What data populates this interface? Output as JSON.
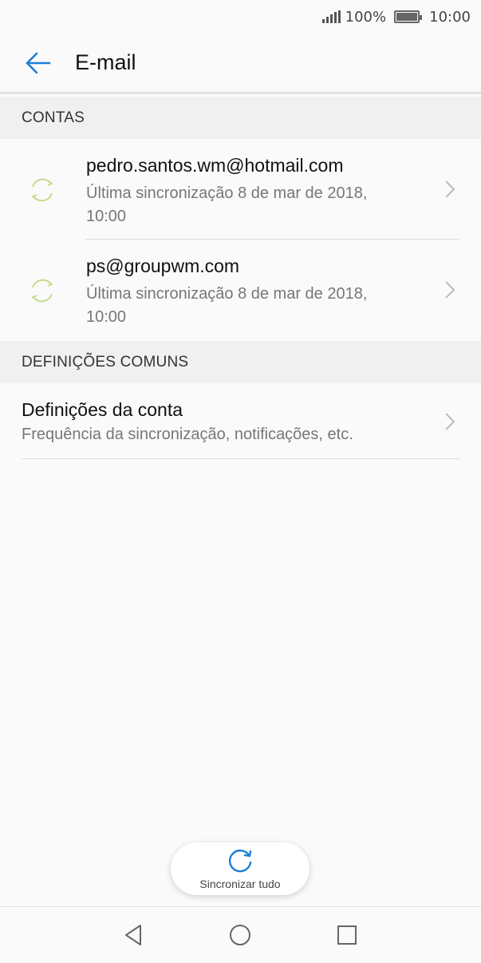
{
  "status_bar": {
    "battery_text": "100%",
    "time": "10:00"
  },
  "app_bar": {
    "title": "E-mail",
    "back_icon": "arrow-left-icon"
  },
  "sections": {
    "accounts_header": "CONTAS",
    "common_header": "DEFINIÇÕES COMUNS"
  },
  "accounts": [
    {
      "email": "pedro.santos.wm@hotmail.com",
      "last_sync": "Última sincronização 8 de mar de 2018, 10:00"
    },
    {
      "email": "ps@groupwm.com",
      "last_sync": "Última sincronização 8 de mar de 2018, 10:00"
    }
  ],
  "account_settings": {
    "title": "Definições da conta",
    "subtitle": "Frequência da sincronização, notificações, etc."
  },
  "sync_all": {
    "label": "Sincronizar tudo"
  },
  "colors": {
    "accent": "#1a7ed6",
    "sync_icon": "#c5dc8c"
  }
}
